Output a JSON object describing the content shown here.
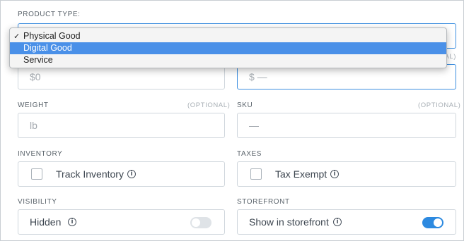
{
  "product_type": {
    "label": "PRODUCT TYPE:",
    "options": [
      {
        "label": "Physical Good",
        "checked": true,
        "highlighted": false
      },
      {
        "label": "Digital Good",
        "checked": false,
        "highlighted": true
      },
      {
        "label": "Service",
        "checked": false,
        "highlighted": false
      }
    ],
    "check_glyph": "✓"
  },
  "price": {
    "placeholder": "$0"
  },
  "compare_price": {
    "optional_fragment": "NAL)",
    "placeholder": "$ —"
  },
  "weight": {
    "label": "WEIGHT",
    "optional": "(OPTIONAL)",
    "placeholder": "lb"
  },
  "sku": {
    "label": "SKU",
    "optional": "(OPTIONAL)",
    "placeholder": "—"
  },
  "inventory": {
    "label": "INVENTORY",
    "checkbox_label": "Track Inventory",
    "checked": false
  },
  "taxes": {
    "label": "TAXES",
    "checkbox_label": "Tax Exempt",
    "checked": false
  },
  "visibility": {
    "label": "VISIBILITY",
    "toggle_label": "Hidden",
    "on": false
  },
  "storefront": {
    "label": "STOREFRONT",
    "toggle_label": "Show in storefront",
    "on": true
  },
  "info_glyph": "i",
  "colors": {
    "accent": "#2d8ae0",
    "highlight": "#4a90e8",
    "border": "#cfd6dc"
  }
}
